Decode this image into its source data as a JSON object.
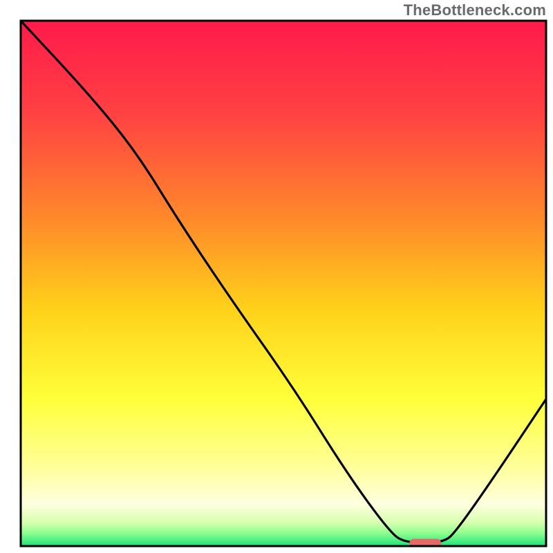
{
  "watermark": "TheBottleneck.com",
  "chart_data": {
    "type": "line",
    "title": "",
    "xlabel": "",
    "ylabel": "",
    "xlim": [
      0,
      100
    ],
    "ylim": [
      0,
      100
    ],
    "gradient_stops": [
      {
        "offset": 0,
        "color": "#ff1a4b"
      },
      {
        "offset": 18,
        "color": "#ff4242"
      },
      {
        "offset": 38,
        "color": "#ff8a2a"
      },
      {
        "offset": 55,
        "color": "#ffd21a"
      },
      {
        "offset": 72,
        "color": "#ffff3a"
      },
      {
        "offset": 85,
        "color": "#ffff9a"
      },
      {
        "offset": 92,
        "color": "#ffffe0"
      },
      {
        "offset": 95.5,
        "color": "#d8ffb0"
      },
      {
        "offset": 97.5,
        "color": "#8fff8f"
      },
      {
        "offset": 100,
        "color": "#1de27a"
      }
    ],
    "curve": [
      {
        "x": 0,
        "y": 100
      },
      {
        "x": 13,
        "y": 86
      },
      {
        "x": 22,
        "y": 75
      },
      {
        "x": 30,
        "y": 62
      },
      {
        "x": 40,
        "y": 47
      },
      {
        "x": 52,
        "y": 30
      },
      {
        "x": 62,
        "y": 14
      },
      {
        "x": 70,
        "y": 3
      },
      {
        "x": 73,
        "y": 0.6
      },
      {
        "x": 80.5,
        "y": 0.6
      },
      {
        "x": 83,
        "y": 3
      },
      {
        "x": 90,
        "y": 13
      },
      {
        "x": 100,
        "y": 28
      }
    ],
    "marker": {
      "x_start": 74,
      "x_end": 80,
      "y": 0.6,
      "color": "#e46a6a"
    },
    "frame_color": "#000000"
  }
}
